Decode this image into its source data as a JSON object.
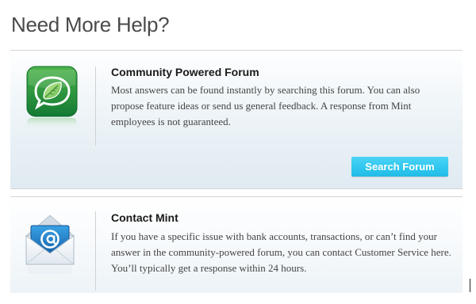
{
  "page": {
    "title": "Need More Help?"
  },
  "forum_card": {
    "title": "Community Powered Forum",
    "body": "Most answers can be found instantly by searching this forum. You can also propose feature ideas or send us general feedback. A response from Mint employees is not guaranteed.",
    "icon": "forum-leaf-chat-icon",
    "button_label": "Search Forum"
  },
  "contact_card": {
    "title": "Contact Mint",
    "body": "If you have a specific issue with bank accounts, transactions, or can’t find your answer in the community-powered forum, you can contact Customer Service here. You’ll typically get a response within 24 hours.",
    "icon": "email-envelope-icon"
  },
  "colors": {
    "button": "#2ec6ee",
    "forum_icon_green": "#1f8a3c",
    "envelope_blue": "#1e6fae"
  }
}
